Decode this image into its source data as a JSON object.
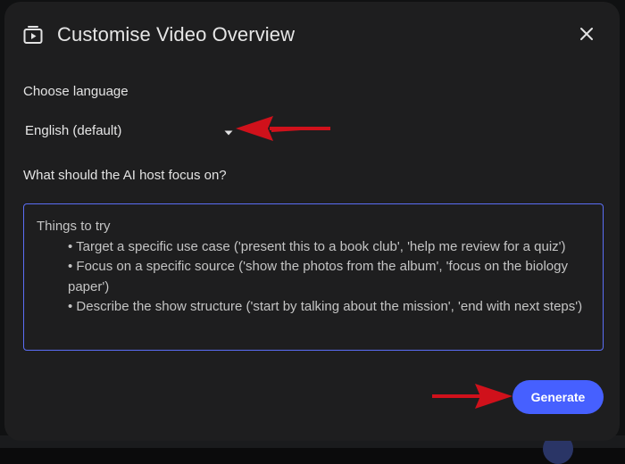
{
  "dialog": {
    "title": "Customise Video Overview",
    "icon": "video-overview-icon",
    "close_icon": "close-icon"
  },
  "language": {
    "label": "Choose language",
    "selected": "English (default)",
    "arrow_icon": "dropdown-arrow-icon"
  },
  "focus": {
    "label": "What should the AI host focus on?",
    "placeholder_heading": "Things to try",
    "placeholder_items": [
      "• Target a specific use case ('present this to a book club', 'help me review for a quiz')",
      "• Focus on a specific source ('show the photos from the album', 'focus on the biology paper')",
      "• Describe the show structure ('start by talking about the mission', 'end with next steps')"
    ]
  },
  "actions": {
    "generate_label": "Generate"
  },
  "colors": {
    "dialog_bg": "#1e1e1f",
    "accent": "#4660ff",
    "focus_border": "#5b6ef5",
    "annotation_arrow": "#d0111b"
  }
}
